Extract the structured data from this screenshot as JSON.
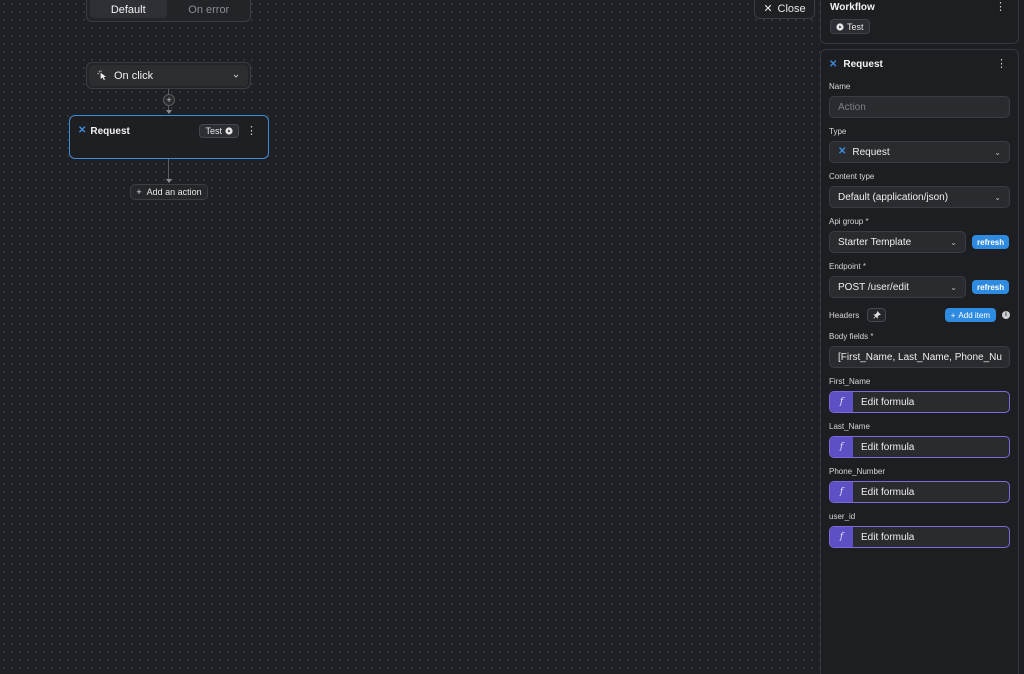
{
  "canvas": {
    "branch_tabs": [
      "Default",
      "On error"
    ],
    "trigger_label": "On click",
    "request_node": {
      "title": "Request",
      "test_label": "Test"
    },
    "add_action_label": "Add an action",
    "close_label": "Close"
  },
  "panel": {
    "workflow": {
      "title": "Workflow",
      "test_label": "Test"
    },
    "request": {
      "title": "Request",
      "fields": {
        "name": {
          "label": "Name",
          "placeholder": "Action"
        },
        "type": {
          "label": "Type",
          "value": "Request"
        },
        "content_type": {
          "label": "Content type",
          "value": "Default (application/json)"
        },
        "api_group": {
          "label": "Api group",
          "value": "Starter Template",
          "refresh": "refresh"
        },
        "endpoint": {
          "label": "Endpoint",
          "value": "POST /user/edit",
          "refresh": "refresh"
        },
        "headers": {
          "label": "Headers",
          "add_item": "Add item"
        },
        "body_fields": {
          "label": "Body fields",
          "value": "[First_Name, Last_Name, Phone_Nu"
        }
      },
      "formula_fields": [
        {
          "label": "First_Name",
          "button": "Edit formula"
        },
        {
          "label": "Last_Name",
          "button": "Edit formula"
        },
        {
          "label": "Phone_Number",
          "button": "Edit formula"
        },
        {
          "label": "user_id",
          "button": "Edit formula"
        }
      ]
    }
  },
  "colors": {
    "accent": "#2f8be0",
    "formula": "#5d4fc4",
    "selected_border": "#3d8bd9"
  }
}
